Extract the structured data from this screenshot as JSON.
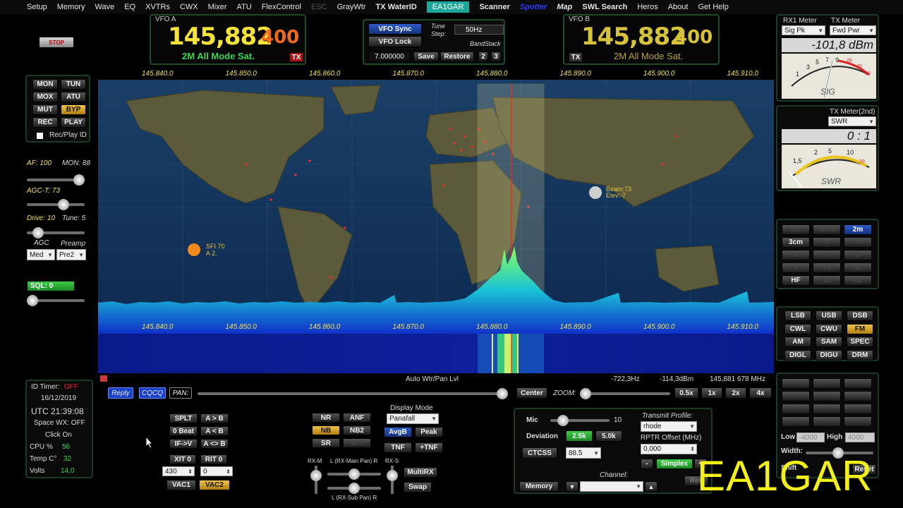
{
  "menu": [
    "Setup",
    "Memory",
    "Wave",
    "EQ",
    "XVTRs",
    "CWX",
    "Mixer",
    "ATU",
    "FlexControl",
    "ESC",
    "GrayWtr",
    "TX WaterID",
    "EA1GAR",
    "Scanner",
    "Spotter",
    "Map",
    "SWL Search",
    "Heros",
    "About",
    "Get Help"
  ],
  "stop_label": "STOP",
  "vfo_a": {
    "title": "VFO A",
    "freq_main": "145,882",
    "freq_sub": "400",
    "mode": "2M All Mode Sat.",
    "tx": "TX"
  },
  "vfo_b": {
    "title": "VFO B",
    "freq_main": "145,882",
    "freq_sub": "400",
    "mode": "2M All Mode Sat.",
    "tx": "TX"
  },
  "vfo_center": {
    "sync": "VFO Sync",
    "lock": "VFO Lock",
    "tune_step_label": "Tune Step:",
    "tune_step": "50Hz",
    "bandstack": "BandStack",
    "freq": "7.000000",
    "save": "Save",
    "restore": "Restore",
    "b2": "2",
    "b3": "3"
  },
  "left_buttons": {
    "mon": "MON",
    "tun": "TUN",
    "mox": "MOX",
    "atu": "ATU",
    "mut": "MUT",
    "byp": "BYP",
    "rec": "REC",
    "play": "PLAY",
    "recplay": "Rec/Play ID"
  },
  "left_levels": {
    "af": "AF: 100",
    "mon": "MON: 88",
    "agct": "AGC-T: 73",
    "drive": "Drive: 10",
    "tune": "Tune: 5",
    "agc": "AGC",
    "preamp": "Preamp",
    "agc_val": "Med",
    "preamp_val": "Pre2",
    "sql": "SQL: 0"
  },
  "info": {
    "id_timer": "ID Timer:",
    "id_timer_val": "OFF",
    "date": "16/12/2019",
    "utc": "UTC  21:39:08",
    "space_wx": "Space WX: OFF",
    "click": "Click On",
    "cpu": "CPU %",
    "cpu_val": "56",
    "temp": "Temp C°",
    "temp_val": "32",
    "volts": "Volts",
    "volts_val": "14.0"
  },
  "freq_ticks": [
    "145.840.0",
    "145.850.0",
    "145.860.0",
    "145.870.0",
    "145.880.0",
    "145.890.0",
    "145.900.0",
    "145.910.0"
  ],
  "map_labels": {
    "sfi": "SFI 70",
    "a": "A 2.",
    "beam": "Beam:73",
    "elev": "Elev:-7"
  },
  "status_row": {
    "auto": "Auto Wtr/Pan Lvl",
    "offset": "-722,3Hz",
    "dbm": "-114,3dBm",
    "cursor": "145,881 678 MHz"
  },
  "pan_row": {
    "reply": "Reply",
    "cqcq": "CQCQ",
    "pan": "PAN:",
    "center": "Center",
    "zoom": "ZOOM:",
    "z1": "0.5x",
    "z2": "1x",
    "z3": "2x",
    "z4": "4x"
  },
  "dsp_left": {
    "splt": "SPLT",
    "ab": "A > B",
    "beat": "0 Beat",
    "ba": "A < B",
    "ifv": "IF->V",
    "swap": "A <> B",
    "xit": "XIT",
    "xit_v": "0",
    "rit": "RIT",
    "rit_v": "0",
    "xit_val": "430",
    "rit_val": "0",
    "vac1": "VAC1",
    "vac2": "VAC2"
  },
  "dsp_mid": {
    "nr": "NR",
    "anf": "ANF",
    "nb": "NB",
    "nb2": "NB2",
    "sr": "SR",
    "bin": "BIN",
    "display_mode": "Display Mode",
    "display_val": "Panafall",
    "avgb": "AvgB",
    "peak": "Peak",
    "tnf": "TNF",
    "ptnf": "+TNF",
    "rxm": "RX-M",
    "lmain": "L (RX-Main Pan) R",
    "rxs": "RX-S",
    "lsub": "L (RX-Sub Pan) R",
    "multirx": "MultiRX",
    "swap": "Swap"
  },
  "tx_panel": {
    "mic": "Mic",
    "mic_val": "10",
    "deviation": "Deviation",
    "d1": "2.5k",
    "d2": "5.0k",
    "ctcss": "CTCSS",
    "ctcss_val": "88.5",
    "profile_label": "Transmit Profile:",
    "profile": "rhode",
    "rptr": "RPTR Offset (MHz)",
    "rptr_val": "0,000",
    "minus": "-",
    "simplex": "Simplex",
    "plus": "+",
    "channel": "Channel:",
    "memory": "Memory",
    "rev": "Rev"
  },
  "rx1_meter": {
    "title": "RX1 Meter",
    "tx_title": "TX Meter",
    "sel1": "Sig Pk",
    "sel2": "Fwd Pwr",
    "reading": "-101,8 dBm",
    "scale": "SIG"
  },
  "tx_meter2": {
    "title": "TX Meter(2nd)",
    "sel": "SWR",
    "reading": "0 : 1",
    "scale": "SWR"
  },
  "bands": [
    "2m",
    "70cm",
    "2m",
    "3cm",
    "4",
    "5",
    "6",
    "7",
    "8",
    "9",
    "10",
    "11",
    "HF",
    "12",
    "13"
  ],
  "modes": [
    "LSB",
    "USB",
    "DSB",
    "CWL",
    "CWU",
    "FM",
    "AM",
    "SAM",
    "SPEC",
    "DIGL",
    "DIGU",
    "DRM"
  ],
  "filter": {
    "low": "Low",
    "low_val": "-4000",
    "high": "High",
    "high_val": "4000",
    "width": "Width:",
    "shift": "Shift",
    "reset": "Reset"
  },
  "callsign": "EA1GAR",
  "colors": {
    "accent": "#f5e34a",
    "freq_a": "#f6e33a",
    "freq_sub": "#f06a1c",
    "panel_border": "#1c3a26"
  }
}
